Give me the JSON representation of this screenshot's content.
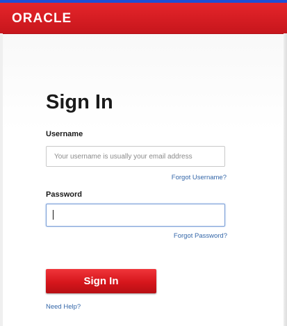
{
  "header": {
    "logo_text": "ORACLE",
    "brand_color": "#d51a20",
    "logo_icon": "oracle-logo"
  },
  "form": {
    "title": "Sign In",
    "username": {
      "label": "Username",
      "placeholder": "Your username is usually your email address",
      "value": ""
    },
    "forgot_username": "Forgot Username?",
    "password": {
      "label": "Password",
      "value": ""
    },
    "forgot_password": "Forgot Password?",
    "submit_label": "Sign In",
    "help_link": "Need Help?"
  },
  "colors": {
    "link": "#3366a8",
    "button": "#d6161c"
  }
}
